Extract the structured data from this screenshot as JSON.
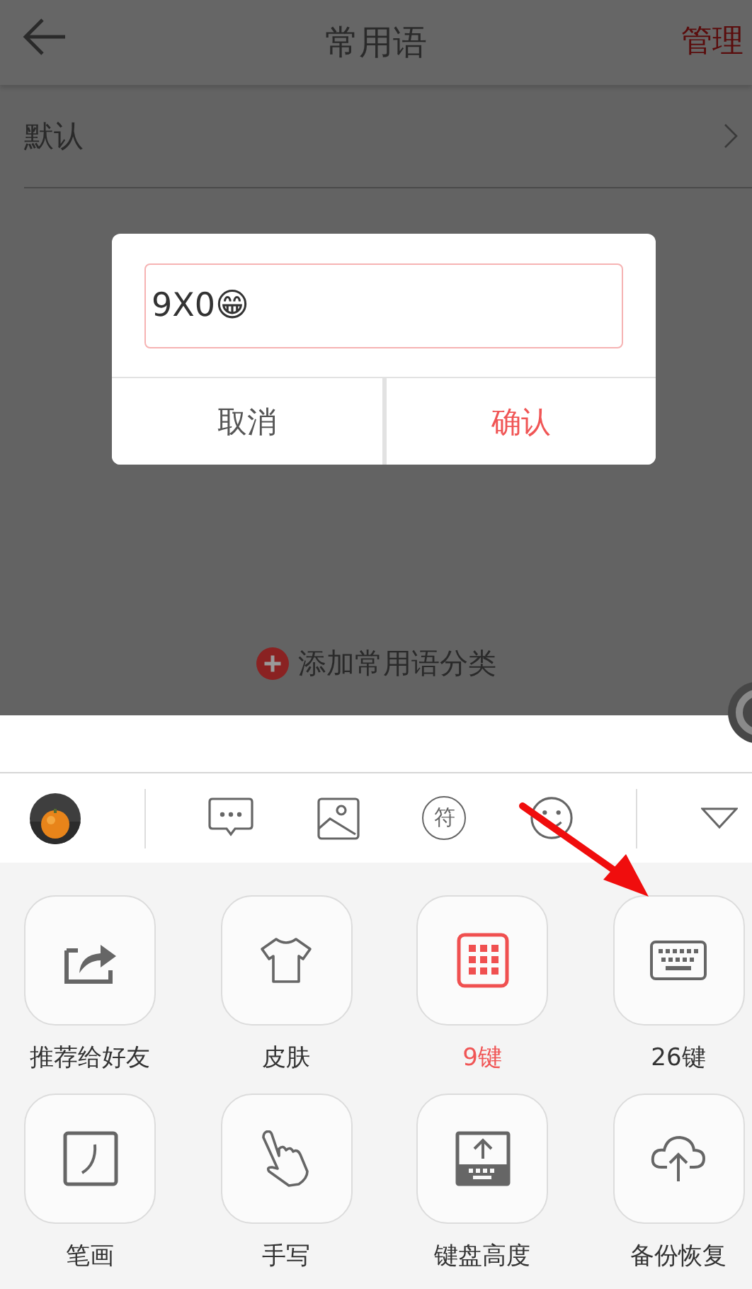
{
  "header": {
    "title": "常用语",
    "action": "管理"
  },
  "categories": [
    {
      "label": "默认"
    }
  ],
  "dialog": {
    "input_value": "9X0😁",
    "buttons": [
      {
        "label": "取消",
        "kind": "cancel"
      },
      {
        "label": "确认",
        "kind": "confirm"
      }
    ]
  },
  "add_category": "添加常用语分类",
  "toolbar": {
    "symbol_label": "符"
  },
  "menu": [
    {
      "label": "推荐给好友",
      "kind": "share",
      "selected": false
    },
    {
      "label": "皮肤",
      "kind": "skin",
      "selected": false
    },
    {
      "label": "9键",
      "kind": "nine",
      "selected": true
    },
    {
      "label": "26键",
      "kind": "full",
      "selected": false
    },
    {
      "label": "笔画",
      "kind": "stroke",
      "selected": false
    },
    {
      "label": "手写",
      "kind": "hand",
      "selected": false
    },
    {
      "label": "键盘高度",
      "kind": "height",
      "selected": false
    },
    {
      "label": "备份恢复",
      "kind": "backup",
      "selected": false
    }
  ]
}
